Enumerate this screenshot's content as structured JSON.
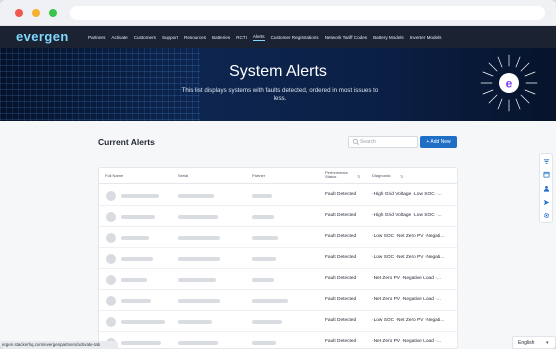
{
  "app": {
    "logo": "evergen"
  },
  "nav": {
    "links": [
      "Partners",
      "Activate",
      "Customers",
      "Support",
      "Resources",
      "Batteries",
      "RCTI",
      "Alerts",
      "Customer Registrations",
      "Network Tariff Codes",
      "Battery Models",
      "Inverter Models"
    ],
    "active": "Alerts"
  },
  "hero": {
    "title": "System Alerts",
    "subtitle": "This list displays systems with faults detected, ordered in most issues to less."
  },
  "alerts": {
    "title": "Current Alerts",
    "search_placeholder": "Search",
    "add_label": "+ Add New",
    "columns": [
      "Full Name",
      "Serial",
      "Partner",
      "Performance Status",
      "Diagnostic"
    ],
    "rows": [
      {
        "status": "Fault Detected",
        "diagnostic": "·High Grid Voltage ·Low SOC ·..."
      },
      {
        "status": "Fault Detected",
        "diagnostic": "·High Grid Voltage ·Low SOC ·..."
      },
      {
        "status": "Fault Detected",
        "diagnostic": "·Low SOC ·Net Zero PV ·Negati..."
      },
      {
        "status": "Fault Detected",
        "diagnostic": "·Low SOC ·Net Zero PV ·Negati..."
      },
      {
        "status": "Fault Detected",
        "diagnostic": "·Net Zero PV ·Negative Load ·..."
      },
      {
        "status": "Fault Detected",
        "diagnostic": "·Net Zero PV ·Negative Load ·..."
      },
      {
        "status": "Fault Detected",
        "diagnostic": "·Low SOC ·Net Zero PV ·Negati..."
      },
      {
        "status": "Fault Detected",
        "diagnostic": "·Net Zero PV ·Negative Load ·..."
      }
    ]
  },
  "statusbar": {
    "url": "ergen.stackerhq.com/evergenpartners/activate-tab"
  },
  "language": {
    "label": "English"
  },
  "colors": {
    "accent": "#1f6fc7",
    "nav_bg": "#1b2231",
    "logo": "#7fd8ff"
  }
}
